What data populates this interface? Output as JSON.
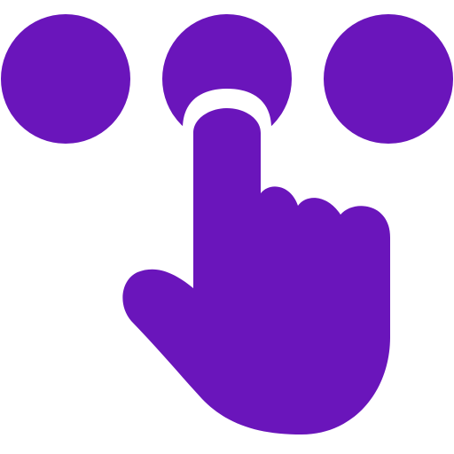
{
  "icon": {
    "name": "tap-gesture-icon",
    "parts": [
      "dot-left",
      "dot-middle",
      "dot-right",
      "pointing-hand"
    ]
  },
  "colors": {
    "primary": "#6a15bb",
    "background": "#ffffff"
  }
}
